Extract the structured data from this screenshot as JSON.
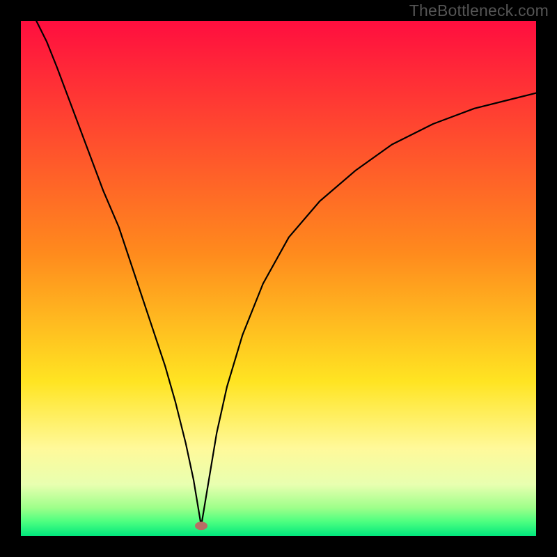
{
  "watermark": "TheBottleneck.com",
  "chart_data": {
    "type": "line",
    "title": "",
    "xlabel": "",
    "ylabel": "",
    "xlim": [
      0,
      100
    ],
    "ylim": [
      0,
      100
    ],
    "x": [
      3,
      5,
      7,
      10,
      13,
      16,
      19,
      22,
      25,
      28,
      30,
      32,
      33.5,
      34.5,
      35,
      35.5,
      36.5,
      38,
      40,
      43,
      47,
      52,
      58,
      65,
      72,
      80,
      88,
      96,
      100
    ],
    "values": [
      100,
      96,
      91,
      83,
      75,
      67,
      60,
      51,
      42,
      33,
      26,
      18,
      11,
      5,
      2,
      5,
      11,
      20,
      29,
      39,
      49,
      58,
      65,
      71,
      76,
      80,
      83,
      85,
      86
    ],
    "series_name": "bottleneck-curve",
    "annotations": [],
    "min_point": {
      "x": 35,
      "y": 2
    },
    "gradient_bands": [
      {
        "pos": 0.0,
        "color": "#ff0e3f"
      },
      {
        "pos": 0.45,
        "color": "#ff8a1d"
      },
      {
        "pos": 0.7,
        "color": "#ffe422"
      },
      {
        "pos": 0.83,
        "color": "#fff99a"
      },
      {
        "pos": 0.9,
        "color": "#e8ffb0"
      },
      {
        "pos": 0.945,
        "color": "#9eff8a"
      },
      {
        "pos": 0.972,
        "color": "#4dff80"
      },
      {
        "pos": 1.0,
        "color": "#00e77d"
      }
    ]
  }
}
